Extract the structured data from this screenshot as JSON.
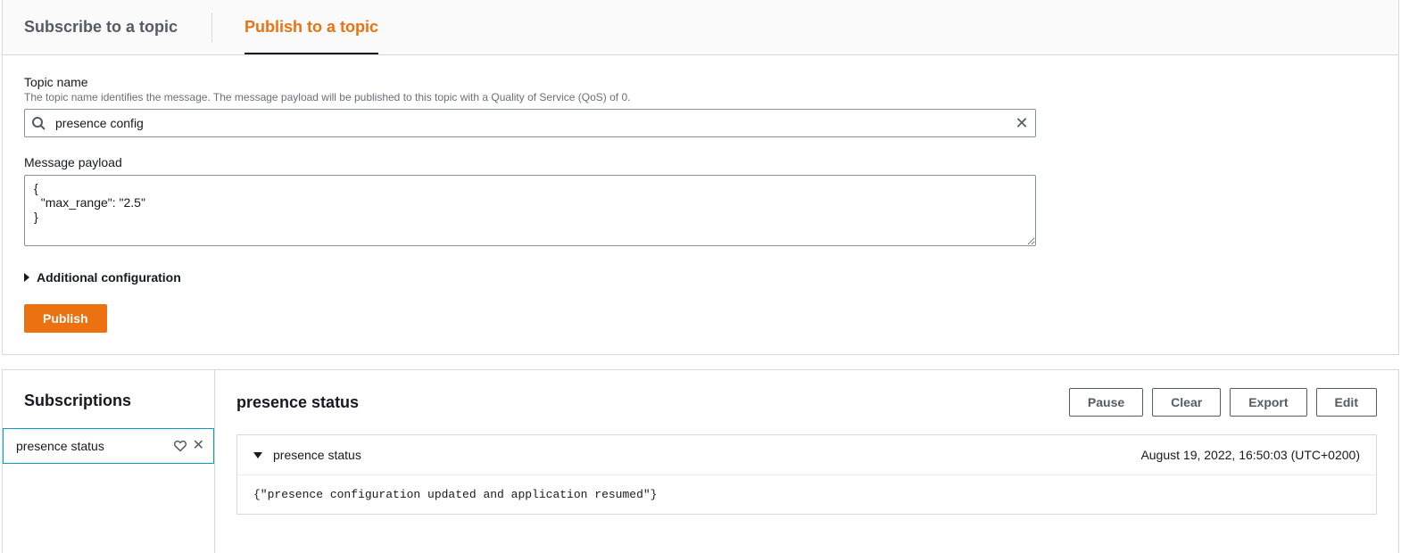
{
  "tabs": {
    "subscribe": "Subscribe to a topic",
    "publish": "Publish to a topic"
  },
  "publish": {
    "topic_label": "Topic name",
    "topic_hint": "The topic name identifies the message. The message payload will be published to this topic with a Quality of Service (QoS) of 0.",
    "topic_value": "presence config",
    "payload_label": "Message payload",
    "payload_value": "{\n  \"max_range\": \"2.5\"\n}",
    "additional_config": "Additional configuration",
    "publish_btn": "Publish"
  },
  "subscriptions": {
    "header": "Subscriptions",
    "items": [
      {
        "name": "presence status"
      }
    ]
  },
  "message_view": {
    "title": "presence status",
    "actions": {
      "pause": "Pause",
      "clear": "Clear",
      "export": "Export",
      "edit": "Edit"
    },
    "messages": [
      {
        "topic": "presence status",
        "timestamp": "August 19, 2022, 16:50:03 (UTC+0200)",
        "body": "{\"presence configuration updated and application resumed\"}"
      }
    ]
  }
}
